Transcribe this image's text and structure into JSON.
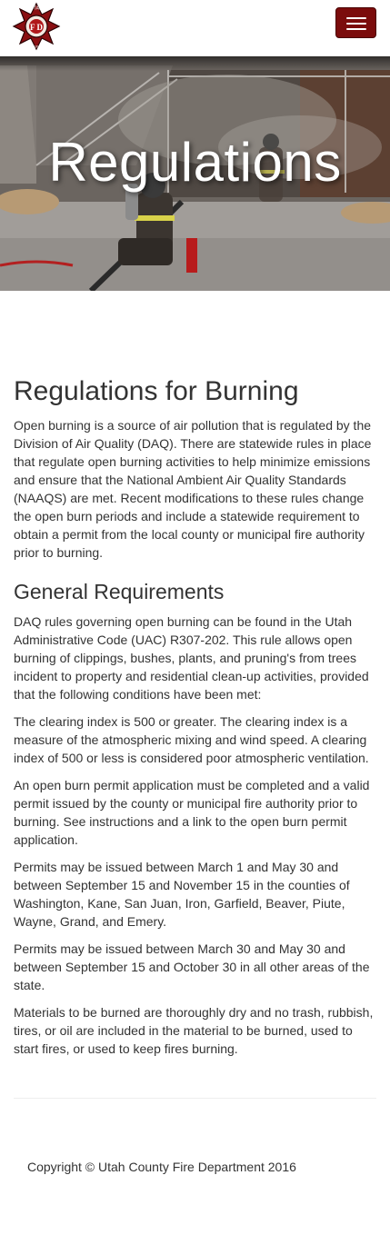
{
  "navbar": {
    "logo_text_top": "UTAH",
    "logo_text_bottom": "COUNTY",
    "logo_letters": "F D",
    "menu_icon": "hamburger-icon"
  },
  "hero": {
    "title": "Regulations"
  },
  "main": {
    "heading": "Regulations for Burning",
    "intro": "Open burning is a source of air pollution that is regulated by the Division of Air Quality (DAQ). There are statewide rules in place that regulate open burning activities to help minimize emissions and ensure that the National Ambient Air Quality Standards (NAAQS) are met. Recent modifications to these rules change the open burn periods and include a statewide requirement to obtain a permit from the local county or municipal fire authority prior to burning.",
    "subheading": "General Requirements",
    "paragraphs": [
      "DAQ rules governing open burning can be found in the Utah Administrative Code (UAC) R307-202. This rule allows open burning of clippings, bushes, plants, and pruning's from trees incident to property and residential clean-up activities, provided that the following conditions have been met:",
      "The clearing index is 500 or greater. The clearing index is a measure of the atmospheric mixing and wind speed. A clearing index of 500 or less is considered poor atmospheric ventilation.",
      "An open burn permit application must be completed and a valid permit issued by the county or municipal fire authority prior to burning. See instructions and a link to the open burn permit application.",
      "Permits may be issued between March 1 and May 30 and between September 15 and November 15 in the counties of Washington, Kane, San Juan, Iron, Garfield, Beaver, Piute, Wayne, Grand, and Emery.",
      "Permits may be issued between March 30 and May 30 and between September 15 and October 30 in all other areas of the state.",
      "Materials to be burned are thoroughly dry and no trash, rubbish, tires, or oil are included in the material to be burned, used to start fires, or used to keep fires burning."
    ]
  },
  "footer": {
    "copyright": "Copyright © Utah County Fire Department 2016"
  },
  "colors": {
    "brand_red": "#7b0c0c",
    "text": "#333333"
  }
}
